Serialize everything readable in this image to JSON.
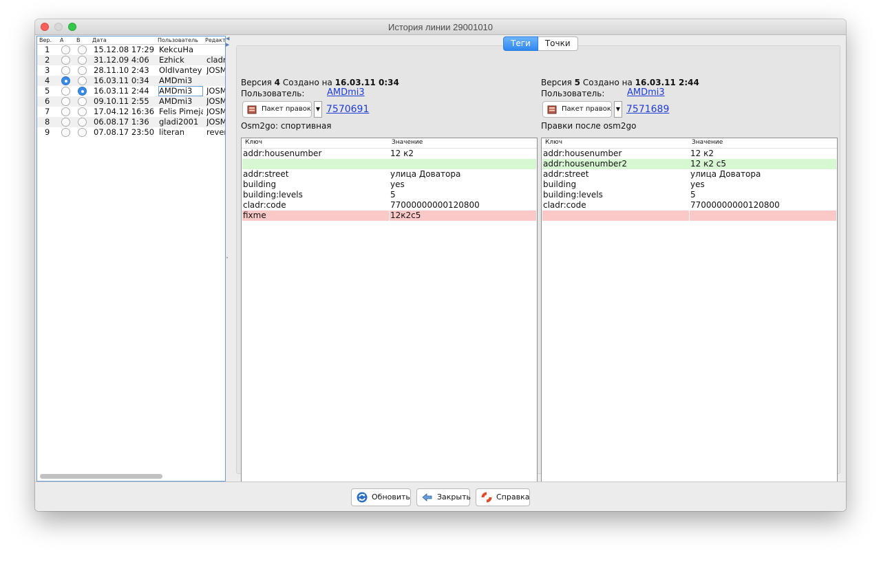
{
  "window": {
    "title": "История линии 29001010"
  },
  "versions": {
    "headers": {
      "ver": "Вер.",
      "a": "A",
      "b": "B",
      "date": "Дата",
      "user": "Пользователь",
      "editor": "Редакт"
    },
    "rows": [
      {
        "ver": "1",
        "date": "15.12.08 17:29",
        "user": "KekcuHa",
        "editor": "",
        "a": false,
        "b": false
      },
      {
        "ver": "2",
        "date": "31.12.09 4:06",
        "user": "Ezhick",
        "editor": "cladr",
        "a": false,
        "b": false
      },
      {
        "ver": "3",
        "date": "28.11.10 2:43",
        "user": "OldIvantey",
        "editor": "JOSM",
        "a": false,
        "b": false
      },
      {
        "ver": "4",
        "date": "16.03.11 0:34",
        "user": "AMDmi3",
        "editor": "",
        "a": true,
        "b": false
      },
      {
        "ver": "5",
        "date": "16.03.11 2:44",
        "user": "AMDmi3",
        "editor": "JOSM",
        "a": false,
        "b": true
      },
      {
        "ver": "6",
        "date": "09.10.11 2:55",
        "user": "AMDmi3",
        "editor": "JOSM",
        "a": false,
        "b": false
      },
      {
        "ver": "7",
        "date": "17.04.12 16:36",
        "user": "Felis Pimeja",
        "editor": "JOSM",
        "a": false,
        "b": false
      },
      {
        "ver": "8",
        "date": "06.08.17 1:36",
        "user": "gladi2001",
        "editor": "JOSM",
        "a": false,
        "b": false
      },
      {
        "ver": "9",
        "date": "07.08.17 23:50",
        "user": "literan",
        "editor": "rever",
        "a": false,
        "b": false
      }
    ]
  },
  "tabs": [
    {
      "label": "Теги",
      "active": true
    },
    {
      "label": "Точки",
      "active": false
    }
  ],
  "left_version": {
    "prefix": "Версия ",
    "number": "4",
    "created_label": " Создано на ",
    "created": "16.03.11 0:34",
    "user_label": "Пользователь:",
    "user": "AMDmi3",
    "changeset_button": "Пакет правок",
    "changeset_id": "7570691",
    "comment": "Osm2go: спортивная"
  },
  "right_version": {
    "prefix": "Версия ",
    "number": "5",
    "created_label": " Создано на ",
    "created": "16.03.11 2:44",
    "user_label": "Пользователь:",
    "user": "AMDmi3",
    "changeset_button": "Пакет правок",
    "changeset_id": "7571689",
    "comment": "Правки после osm2go"
  },
  "tag_headers": {
    "key": "Ключ",
    "value": "Значение"
  },
  "left_tags": [
    {
      "key": "addr:housenumber",
      "value": "12 к2",
      "state": ""
    },
    {
      "key": "",
      "value": "",
      "state": "add"
    },
    {
      "key": "addr:street",
      "value": "улица Доватора",
      "state": ""
    },
    {
      "key": "building",
      "value": "yes",
      "state": ""
    },
    {
      "key": "building:levels",
      "value": "5",
      "state": ""
    },
    {
      "key": "cladr:code",
      "value": "77000000000120800",
      "state": ""
    },
    {
      "key": "fixme",
      "value": "12к2с5",
      "state": "del"
    }
  ],
  "right_tags": [
    {
      "key": "addr:housenumber",
      "value": "12 к2",
      "state": ""
    },
    {
      "key": "addr:housenumber2",
      "value": "12 к2 с5",
      "state": "add"
    },
    {
      "key": "addr:street",
      "value": "улица Доватора",
      "state": ""
    },
    {
      "key": "building",
      "value": "yes",
      "state": ""
    },
    {
      "key": "building:levels",
      "value": "5",
      "state": ""
    },
    {
      "key": "cladr:code",
      "value": "77000000000120800",
      "state": ""
    },
    {
      "key": "",
      "value": "",
      "state": "del"
    }
  ],
  "buttons": {
    "refresh": "Обновить",
    "close": "Закрыть",
    "help": "Справка"
  },
  "colors": {
    "accent": "#3a8ae8",
    "added_row": "#d7f7d3",
    "removed_row": "#fbc8c8",
    "link": "#1d3bd6"
  }
}
